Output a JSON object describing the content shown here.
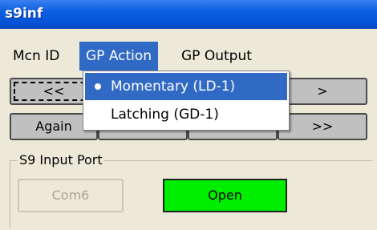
{
  "window": {
    "title": "s9inf"
  },
  "menu": {
    "items": [
      "Mcn ID",
      "GP Action",
      "GP Output"
    ],
    "open_menu": {
      "items": [
        {
          "label": "Momentary (LD-1)",
          "checked": true
        },
        {
          "label": "Latching (GD-1)",
          "checked": false
        }
      ]
    }
  },
  "nav": {
    "row1": [
      "<<",
      ">"
    ],
    "row2": [
      "Again",
      ">>"
    ]
  },
  "group": {
    "label": "S9 Input Port",
    "port_button": "Com6",
    "open_button": "Open"
  },
  "colors": {
    "titlebar": "#0551d6",
    "highlight": "#316ac5",
    "open_button": "#00ee00",
    "button_face": "#c0c0c0"
  }
}
